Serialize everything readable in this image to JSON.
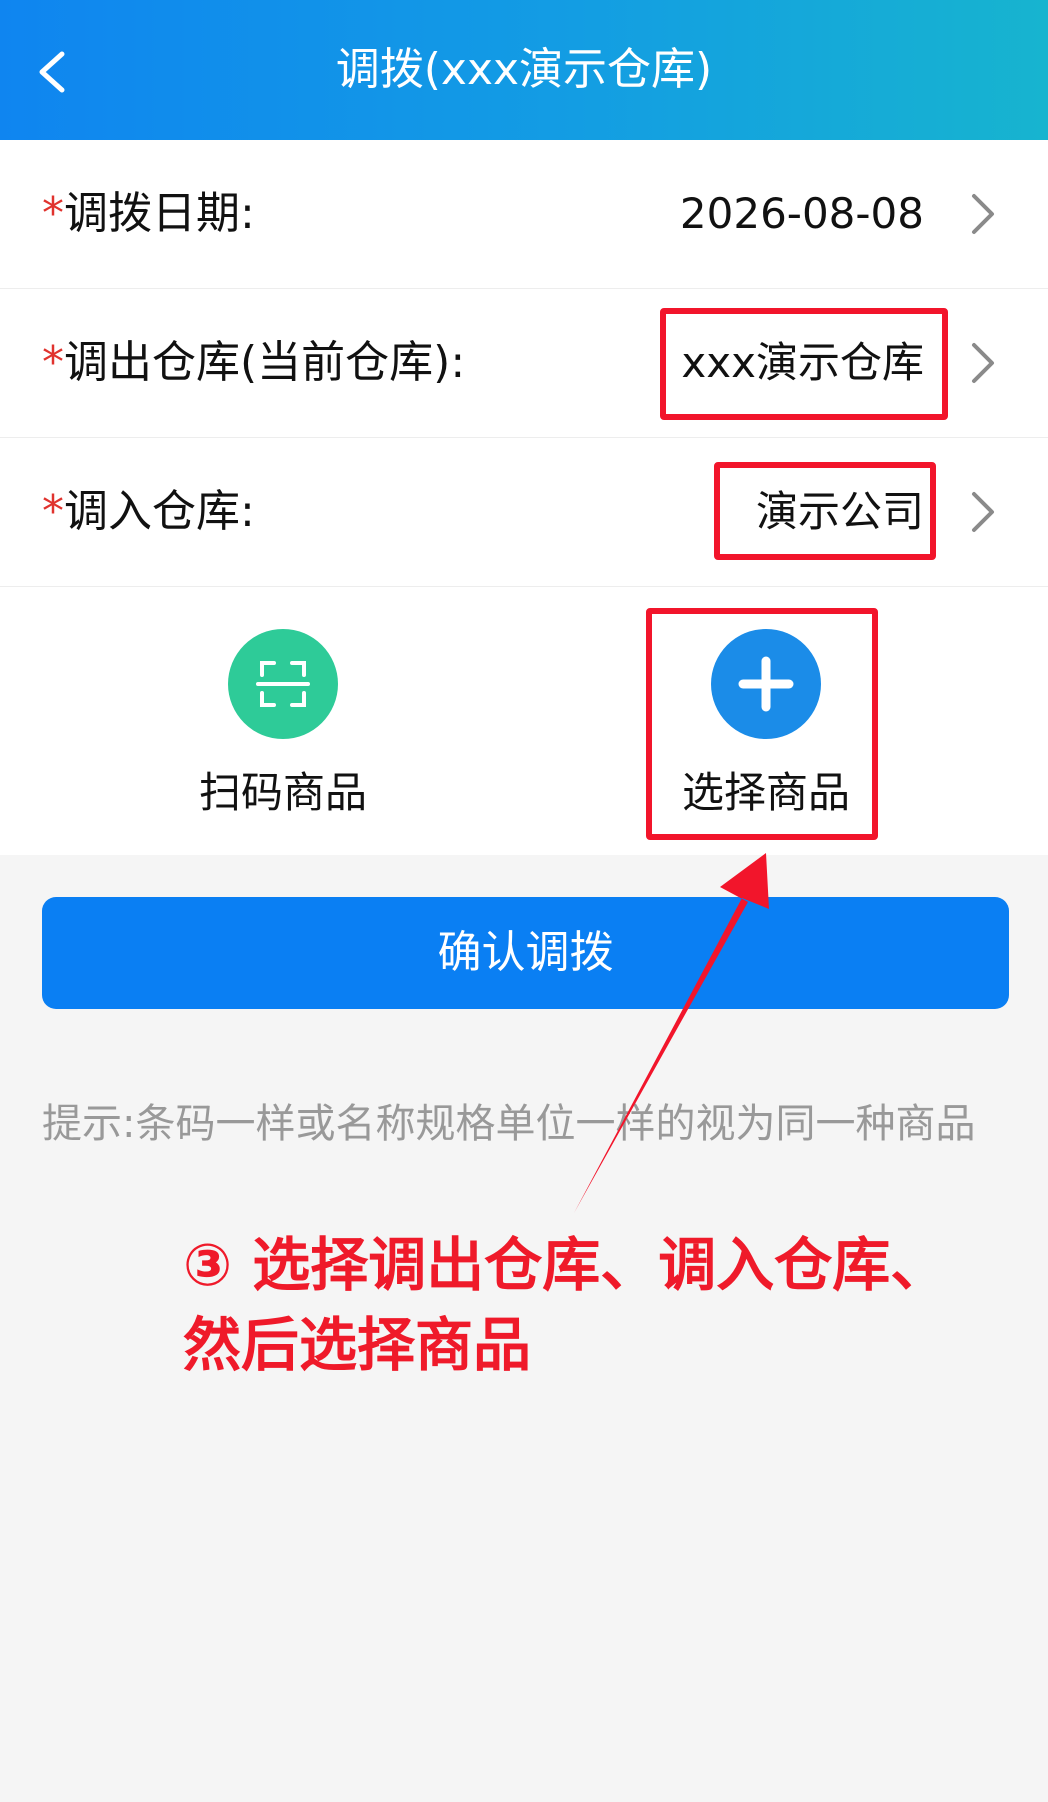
{
  "header": {
    "title": "调拨(xxx演示仓库)",
    "back_icon": "chevron-left-icon"
  },
  "form": {
    "required_mark": "*",
    "rows": [
      {
        "label": "调拨日期:",
        "value": "2026-08-08"
      },
      {
        "label": "调出仓库(当前仓库):",
        "value": "xxx演示仓库"
      },
      {
        "label": "调入仓库:",
        "value": "演示公司"
      }
    ]
  },
  "actions": {
    "scan": {
      "label": "扫码商品",
      "icon": "scan-icon",
      "color": "#2ecb98"
    },
    "select": {
      "label": "选择商品",
      "icon": "plus-icon",
      "color": "#1b8ce8"
    }
  },
  "confirm_button": {
    "label": "确认调拨",
    "color": "#0a7ff3"
  },
  "hint": {
    "text": "提示:条码一样或名称规格单位一样的视为同一种商品"
  },
  "annotation": {
    "line1": "③ 选择调出仓库、调入仓库、",
    "line2": "然后选择商品",
    "color": "#ef1a2a"
  },
  "colors": {
    "header_start": "#0f85f0",
    "header_end": "#17b4cf",
    "required": "#e0332e",
    "highlight": "#f2152b"
  }
}
